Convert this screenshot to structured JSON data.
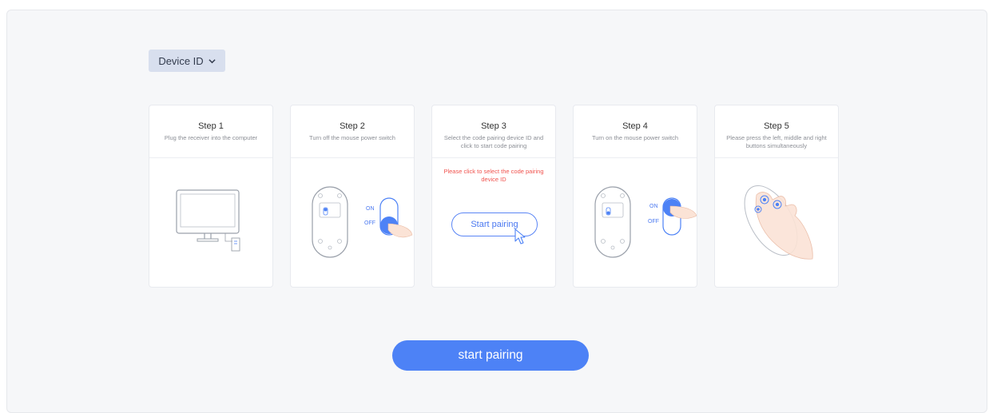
{
  "device_select": {
    "label": "Device ID"
  },
  "steps": [
    {
      "title": "Step 1",
      "desc": "Plug the receiver into the computer"
    },
    {
      "title": "Step 2",
      "desc": "Turn off the mouse power switch",
      "on": "ON",
      "off": "OFF"
    },
    {
      "title": "Step 3",
      "desc": "Select the code pairing device ID and click to start code pairing",
      "note": "Please click to select the code pairing device ID",
      "button": "Start pairing"
    },
    {
      "title": "Step 4",
      "desc": "Turn on the mouse power switch",
      "on": "ON",
      "off": "OFF"
    },
    {
      "title": "Step 5",
      "desc": "Please press the left, middle and right buttons simultaneously"
    }
  ],
  "start_button": {
    "label": "start pairing"
  },
  "colors": {
    "accent": "#4d82f6",
    "warning": "#f0524d",
    "select_bg": "#d8dfee"
  }
}
